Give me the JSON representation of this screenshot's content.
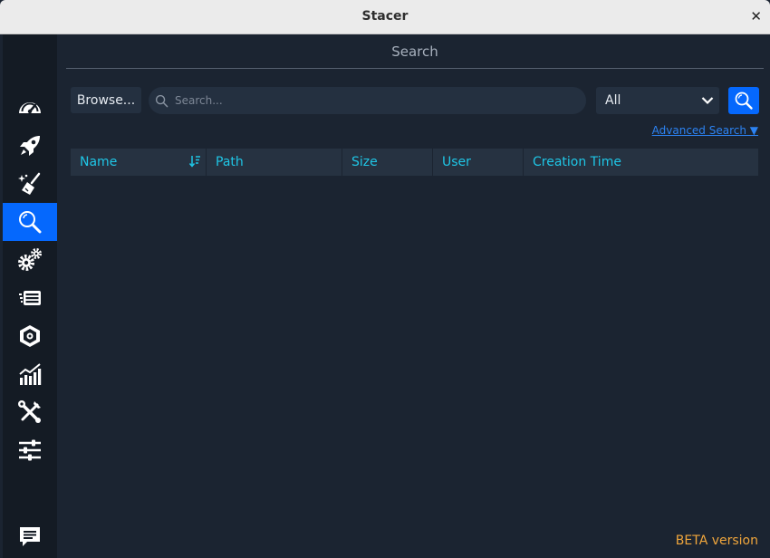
{
  "window": {
    "title": "Stacer",
    "close_glyph": "✕"
  },
  "sidebar": {
    "items": [
      {
        "name": "dashboard-icon",
        "active": false
      },
      {
        "name": "startup-apps-icon",
        "active": false
      },
      {
        "name": "system-cleaner-icon",
        "active": false
      },
      {
        "name": "search-icon",
        "active": true
      },
      {
        "name": "services-icon",
        "active": false
      },
      {
        "name": "processes-icon",
        "active": false
      },
      {
        "name": "uninstaller-icon",
        "active": false
      },
      {
        "name": "resources-icon",
        "active": false
      },
      {
        "name": "helpers-icon",
        "active": false
      },
      {
        "name": "settings-icon",
        "active": false
      },
      {
        "name": "feedback-icon",
        "active": false
      }
    ]
  },
  "page": {
    "title": "Search"
  },
  "toolbar": {
    "browse_label": "Browse...",
    "search_placeholder": "Search...",
    "search_value": "",
    "filter_selected": "All"
  },
  "advanced_search": "Advanced Search ▼",
  "table": {
    "columns": [
      "Name",
      "Path",
      "Size",
      "User",
      "Creation Time"
    ],
    "rows": []
  },
  "footer": {
    "beta": "BETA version"
  },
  "colors": {
    "accent": "#0568fd",
    "header_text": "#1fc6e6",
    "beta": "#f0a63c",
    "link": "#2c83f3"
  }
}
